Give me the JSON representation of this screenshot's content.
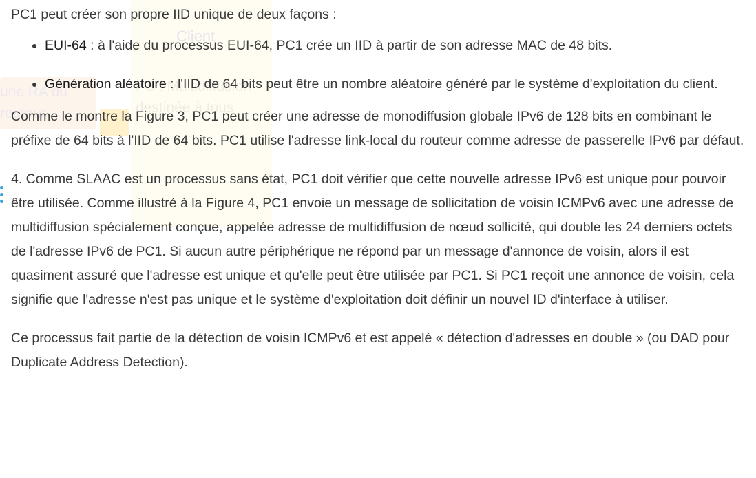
{
  "intro": "PC1 peut créer son propre IID unique de deux façons :",
  "bullets": [
    {
      "term": "EUI-64",
      "text": " : à l'aide du processus EUI-64, PC1 crée un IID à partir de son adresse MAC de 48 bits."
    },
    {
      "term": "Génération aléatoire",
      "text": " : l'IID de 64 bits peut être un nombre aléatoire généré par le système d'exploitation du client."
    }
  ],
  "paragraphs": [
    "Comme le montre la Figure 3, PC1 peut créer une adresse de monodiffusion globale IPv6 de 128 bits en combinant le préfixe de 64 bits à l'IID de 64 bits. PC1 utilise l'adresse link-local du routeur comme adresse de passerelle IPv6 par défaut.",
    "4. Comme SLAAC est un processus sans état, PC1 doit vérifier que cette nouvelle adresse IPv6 est unique pour pouvoir être utilisée. Comme illustré à la Figure 4, PC1 envoie un message de sollicitation de voisin ICMPv6 avec une adresse de multidiffusion spécialement conçue, appelée adresse de multidiffusion de nœud sollicité, qui double les 24 derniers octets de l'adresse IPv6 de PC1. Si aucun autre périphérique ne répond par un message d'annonce de voisin, alors il est quasiment assuré que l'adresse est unique et qu'elle peut être utilisée par PC1. Si PC1 reçoit une annonce de voisin, cela signifie que l'adresse n'est pas unique et le système d'exploitation doit définir un nouvel ID d'interface à utiliser.",
    "Ce processus fait partie de la détection de voisin ICMPv6 et est appelé « détection d'adresses en double » (ou DAD pour Duplicate Address Detection)."
  ],
  "background_figure": {
    "client_label": "Client",
    "router_box_text": "une RA du routeur",
    "ps_text": "PS : Multidiffusion destinée à tous",
    "colors": {
      "column": "#fffdf2",
      "box": "#fdf4ec",
      "yellow_tag": "#fff1cc",
      "dots": "#3aa3dc"
    }
  },
  "colors": {
    "text": "#3a3a3a",
    "term": "#1c1c1c",
    "background": "#ffffff"
  }
}
